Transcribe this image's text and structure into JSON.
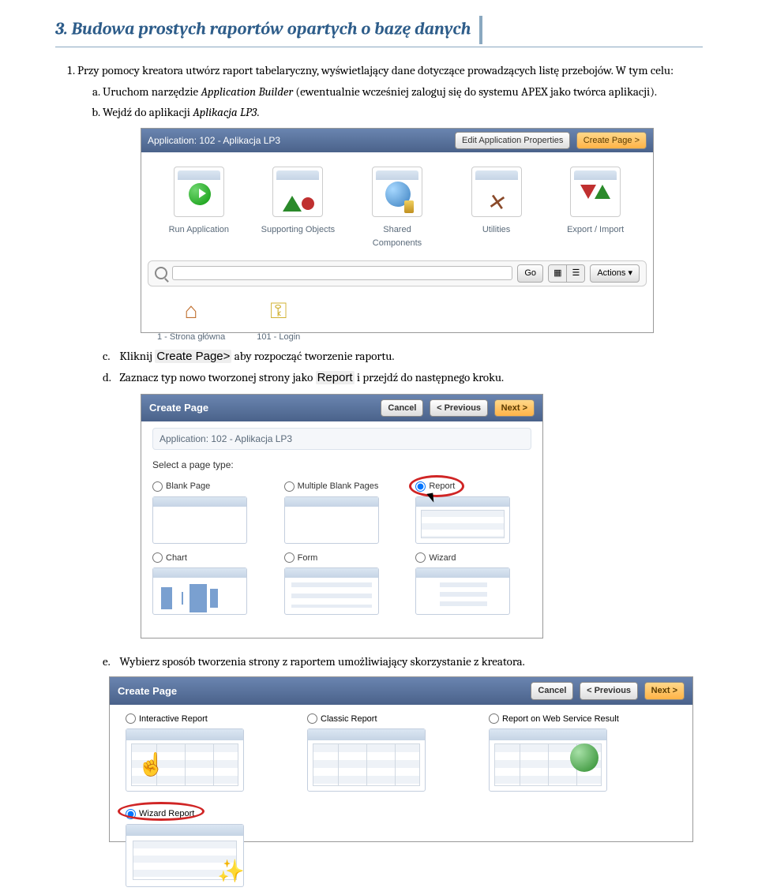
{
  "section": {
    "title": "3. Budowa prostych raportów opartych o bazę danych"
  },
  "step1": {
    "intro": "Przy pomocy kreatora utwórz raport tabelaryczny, wyświetlający dane dotyczące prowadzących listę przebojów. W tym celu:",
    "a_pre": "Uruchom narzędzie ",
    "a_app": "Application Builder",
    "a_post": " (ewentualnie wcześniej zaloguj się do systemu APEX jako twórca aplikacji).",
    "b_pre": "Wejdź do aplikacji ",
    "b_app": "Aplikacja LP3",
    "b_post": ".",
    "c_pre": "Kliknij ",
    "c_btn": "Create Page>",
    "c_post": " aby rozpocząć tworzenie raportu.",
    "d_pre": "Zaznacz typ nowo tworzonej strony jako ",
    "d_btn": "Report",
    "d_post": " i przejdź do następnego kroku.",
    "e": "Wybierz sposób tworzenia strony z raportem umożliwiający skorzystanie z kreatora."
  },
  "shotA": {
    "breadcrumb": "Application: 102 - Aplikacja LP3",
    "btnEdit": "Edit Application Properties",
    "btnCreate": "Create Page >",
    "tiles": [
      "Run Application",
      "Supporting Objects",
      "Shared Components",
      "Utilities",
      "Export / Import"
    ],
    "go": "Go",
    "actions": "Actions ▾",
    "pages": [
      "1 - Strona główna",
      "101 - Login"
    ]
  },
  "shotB": {
    "title": "Create Page",
    "btnCancel": "Cancel",
    "btnPrev": "< Previous",
    "btnNext": "Next >",
    "subtitle": "Application: 102 - Aplikacja LP3",
    "prompt": "Select a page type:",
    "opts": [
      "Blank Page",
      "Multiple Blank Pages",
      "Report",
      "Chart",
      "Form",
      "Wizard"
    ]
  },
  "shotC": {
    "title": "Create Page",
    "btnCancel": "Cancel",
    "btnPrev": "< Previous",
    "btnNext": "Next >",
    "opts": [
      "Interactive Report",
      "Classic Report",
      "Report on Web Service Result"
    ],
    "optWizard": "Wizard Report"
  }
}
